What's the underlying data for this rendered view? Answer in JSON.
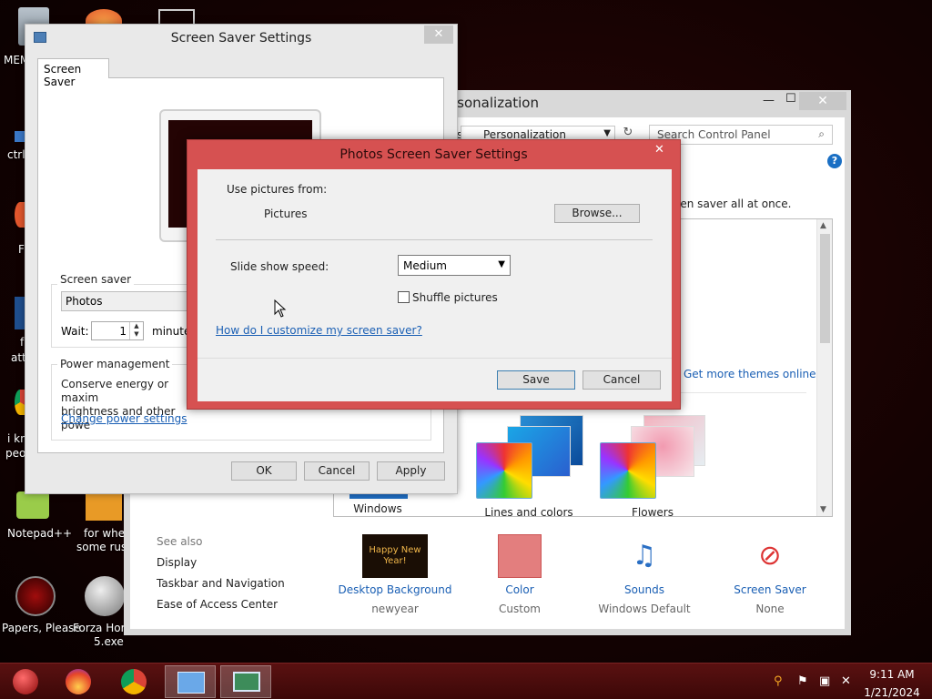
{
  "desktop": {
    "icons": [
      {
        "label": "MEM",
        "name": "desktop-icon-mem"
      },
      {
        "label": "ctrl-",
        "name": "desktop-icon-ctrl"
      },
      {
        "label": "F",
        "name": "desktop-icon-f"
      },
      {
        "label": "f",
        "name": "desktop-icon-f2"
      },
      {
        "label": "att",
        "name": "desktop-icon-att"
      },
      {
        "label": "i kn",
        "name": "desktop-icon-ikn"
      },
      {
        "label": "peo",
        "name": "desktop-icon-peo"
      },
      {
        "label": "Notepad++",
        "name": "desktop-icon-notepad"
      },
      {
        "label": "for when",
        "name": "desktop-icon-forwhen-1"
      },
      {
        "label": "some russ",
        "name": "desktop-icon-forwhen-2"
      },
      {
        "label": "Papers, Please",
        "name": "desktop-icon-papers"
      },
      {
        "label": "Forza Hori",
        "name": "desktop-icon-forza-1"
      },
      {
        "label": "5.exe",
        "name": "desktop-icon-forza-2"
      }
    ]
  },
  "personalization": {
    "title": "rsonalization",
    "address": "Personalization",
    "address_prefix": "s",
    "search_placeholder": "Search Control Panel",
    "help": "?",
    "description": "een saver all at once.",
    "get_more": "Get more themes online",
    "themes": [
      {
        "label": "Windows"
      },
      {
        "label": "Lines and colors"
      },
      {
        "label": "Flowers"
      }
    ],
    "see_also_title": "See also",
    "see_also": [
      "Display",
      "Taskbar and Navigation",
      "Ease of Access Center"
    ],
    "bottom_items": [
      {
        "label": "Desktop Background",
        "sub": "newyear",
        "thumb_text": "Happy New Year!"
      },
      {
        "label": "Color",
        "sub": "Custom"
      },
      {
        "label": "Sounds",
        "sub": "Windows Default"
      },
      {
        "label": "Screen Saver",
        "sub": "None"
      }
    ],
    "close": "✕",
    "minimize": "—",
    "maximize": "☐"
  },
  "screensaver": {
    "title": "Screen Saver Settings",
    "tab": "Screen Saver",
    "group_label": "Screen saver",
    "selected": "Photos",
    "wait_label": "Wait:",
    "wait_value": "1",
    "minutes": "minutes",
    "power_title": "Power management",
    "power_text": "Conserve energy or maximize performance by adjusting display brightness and other power settings.",
    "power_text_visible_1": "Conserve energy or maxim",
    "power_text_visible_2": "brightness and other powe",
    "power_link": "Change power settings",
    "ok": "OK",
    "cancel": "Cancel",
    "apply": "Apply",
    "close": "✕"
  },
  "photos": {
    "title": "Photos Screen Saver Settings",
    "use_pictures_label": "Use pictures from:",
    "pictures_value": "Pictures",
    "browse": "Browse...",
    "speed_label": "Slide show speed:",
    "speed_value": "Medium",
    "shuffle": "Shuffle pictures",
    "help_link": "How do I customize my screen saver?",
    "save": "Save",
    "cancel": "Cancel",
    "close": "✕"
  },
  "taskbar": {
    "time": "9:11 AM",
    "date": "1/21/2024"
  },
  "colors": {
    "photos_frame": "#d65151",
    "link": "#1a5fb4",
    "taskbar": "#4a0c0c"
  }
}
